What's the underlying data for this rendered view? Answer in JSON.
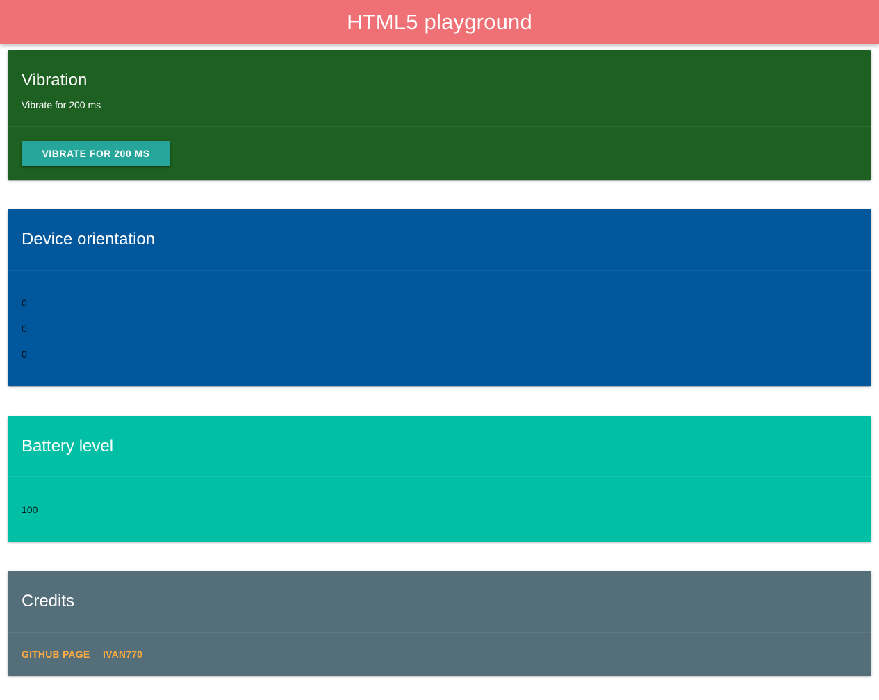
{
  "app": {
    "title": "HTML5 playground",
    "header_color": "#f07175"
  },
  "vibration": {
    "title": "Vibration",
    "subtitle": "Vibrate for 200 ms",
    "button_label": "VIBRATE FOR 200 MS",
    "color": "#1e6021",
    "button_color": "#26a69a"
  },
  "orientation": {
    "title": "Device orientation",
    "values": [
      "0",
      "0",
      "0"
    ],
    "color": "#01579b"
  },
  "battery": {
    "title": "Battery level",
    "level": "100",
    "color": "#00bfa5"
  },
  "credits": {
    "title": "Credits",
    "links": [
      "GITHUB PAGE",
      "IVAN770"
    ],
    "color": "#546e7a",
    "link_color": "#ffab40"
  }
}
